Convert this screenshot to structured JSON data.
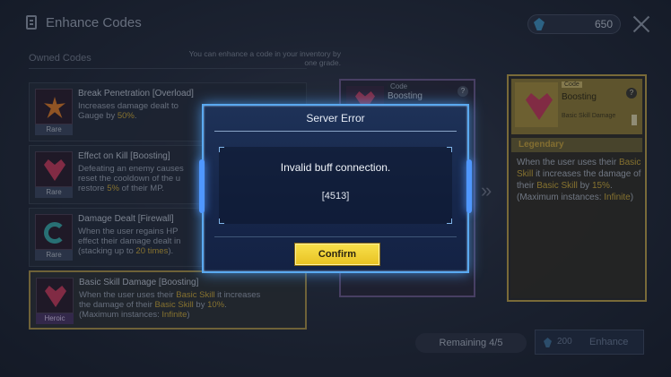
{
  "header": {
    "title": "Enhance Codes",
    "currency_amount": "650"
  },
  "owned": {
    "label": "Owned Codes",
    "hint": "You can enhance a code in your inventory by one grade."
  },
  "list": [
    {
      "name": "Break Penetration [Overload]",
      "desc_a": "Increases damage dealt to ",
      "desc_b": "Gauge by ",
      "desc_hl": "50%",
      "desc_c": ".",
      "rarity": "Rare"
    },
    {
      "name": "Effect on Kill [Boosting]",
      "desc_a": "Defeating an enemy causes ",
      "desc_b": "reset the cooldown of the u",
      "desc_c": "restore ",
      "desc_hl": "5%",
      "desc_d": " of their MP.",
      "rarity": "Rare"
    },
    {
      "name": "Damage Dealt [Firewall]",
      "desc_a": "When the user regains HP",
      "desc_b": "effect their damage dealt in",
      "desc_c": "(stacking up to ",
      "desc_hl": "20 times",
      "desc_d": ").",
      "rarity": "Rare"
    },
    {
      "name": "Basic Skill Damage [Boosting]",
      "desc_a": "When the user uses their ",
      "desc_hl1": "Basic Skill",
      "desc_b": " it increases",
      "desc_c": "the damage of their ",
      "desc_hl2": "Basic Skill",
      "desc_d": " by ",
      "desc_hl3": "10%",
      "desc_e": ".",
      "desc_f": "(Maximum instances: ",
      "desc_hl4": "Infinite",
      "desc_g": ")",
      "rarity": "Heroic"
    }
  ],
  "code_card": {
    "tag": "Code",
    "title": "Boosting",
    "help": "?"
  },
  "legendary_card": {
    "tag": "Code",
    "title": "Boosting",
    "sub": "Basic Skill Damage",
    "help": "?",
    "rarity": "Legendary",
    "d1": "When the user uses their ",
    "hl1": "Basic Skill",
    "d2": " it increases the damage of their ",
    "hl2": "Basic Skill",
    "d3": " by ",
    "hl3": "15%",
    "d4": ". (Maximum instances: ",
    "hl4": "Infinite",
    "d5": ")"
  },
  "footer": {
    "remaining": "Remaining 4/5",
    "enhance_cost": "200",
    "enhance_label": "Enhance"
  },
  "modal": {
    "title": "Server Error",
    "message": "Invalid buff connection.",
    "code": "[4513]",
    "confirm": "Confirm"
  },
  "colors": {
    "modal_border": "#5aa9f0",
    "confirm": "#f2d23a",
    "highlight": "#c8a63c",
    "legendary": "#b59c4a"
  }
}
